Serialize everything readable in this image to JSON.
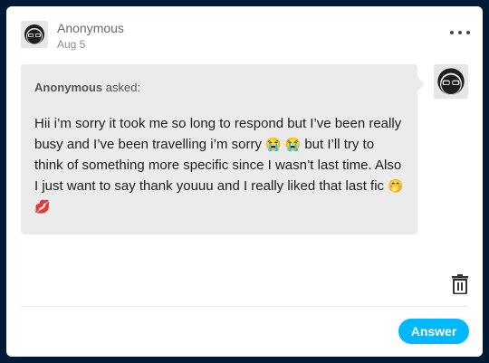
{
  "post": {
    "author": "Anonymous",
    "date": "Aug 5"
  },
  "ask": {
    "asker": "Anonymous",
    "asked_suffix": "asked:",
    "text_part1": "Hii i’m sorry it took me so long to respond but I’ve been really busy and I’ve been travelling i’m sorry",
    "emoji1": "😭",
    "emoji2": "😭",
    "text_part2": "but I’ll try to think of something more specific since I wasn’t last time. Also I just want to say thank youuu and I really liked that last fic",
    "emoji3": "🤭",
    "emoji4": "💋"
  },
  "actions": {
    "answer_label": "Answer",
    "more_icon": "more-dots-icon",
    "delete_icon": "trash-icon"
  },
  "colors": {
    "background": "#001935",
    "accent": "#00b8ff",
    "bubble": "#ebebeb"
  }
}
